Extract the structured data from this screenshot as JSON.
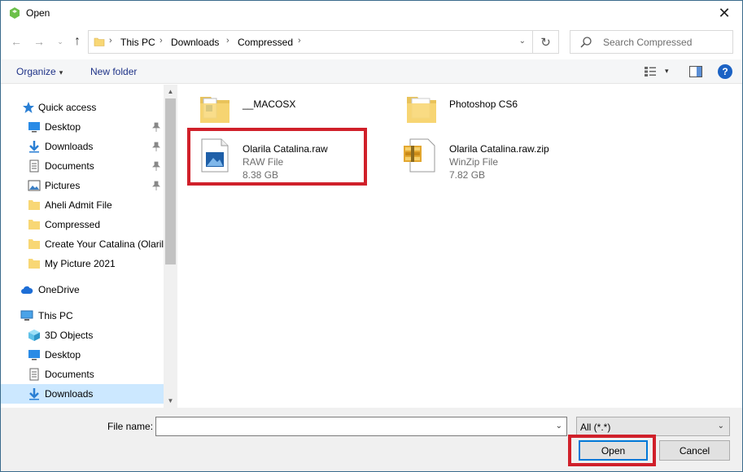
{
  "window": {
    "title": "Open",
    "close_glyph": "✕"
  },
  "nav": {
    "back_glyph": "←",
    "forward_glyph": "→",
    "recent_glyph": "⌄",
    "up_glyph": "↑",
    "breadcrumbs": [
      "This PC",
      "Downloads",
      "Compressed"
    ],
    "separator": "›",
    "dropdown_glyph": "⌄",
    "refresh_glyph": "↻",
    "search_placeholder": "Search Compressed"
  },
  "toolbar": {
    "organize_label": "Organize",
    "new_folder_label": "New folder",
    "caret": "▾",
    "help_label": "?"
  },
  "sidebar": {
    "items": [
      {
        "label": "Quick access",
        "icon": "star-icon",
        "level": 0
      },
      {
        "label": "Desktop",
        "icon": "desktop-icon",
        "level": 1,
        "pinned": true
      },
      {
        "label": "Downloads",
        "icon": "download-icon",
        "level": 1,
        "pinned": true
      },
      {
        "label": "Documents",
        "icon": "documents-icon",
        "level": 1,
        "pinned": true
      },
      {
        "label": "Pictures",
        "icon": "pictures-icon",
        "level": 1,
        "pinned": true
      },
      {
        "label": "Aheli Admit File",
        "icon": "folder-icon",
        "level": 1
      },
      {
        "label": "Compressed",
        "icon": "folder-icon",
        "level": 1
      },
      {
        "label": "Create Your Catalina (Olarila",
        "icon": "folder-icon",
        "level": 1
      },
      {
        "label": "My Picture 2021",
        "icon": "folder-icon",
        "level": 1
      },
      {
        "label": "OneDrive",
        "icon": "cloud-icon",
        "level": 0
      },
      {
        "label": "This PC",
        "icon": "computer-icon",
        "level": 0
      },
      {
        "label": "3D Objects",
        "icon": "cube-icon",
        "level": 1
      },
      {
        "label": "Desktop",
        "icon": "desktop-icon",
        "level": 1
      },
      {
        "label": "Documents",
        "icon": "documents-icon",
        "level": 1
      },
      {
        "label": "Downloads",
        "icon": "download-icon",
        "level": 1,
        "selected": true
      }
    ],
    "scroll_up": "▲",
    "scroll_down": "▼"
  },
  "files": [
    {
      "name": "__MACOSX",
      "type": "",
      "size": "",
      "icon": "folder-icon"
    },
    {
      "name": "Photoshop CS6",
      "type": "",
      "size": "",
      "icon": "folder-icon"
    },
    {
      "name": "Olarila Catalina.raw",
      "type": "RAW File",
      "size": "8.38 GB",
      "icon": "image-file-icon",
      "highlighted": true
    },
    {
      "name": "Olarila Catalina.raw.zip",
      "type": "WinZip File",
      "size": "7.82 GB",
      "icon": "zip-file-icon"
    }
  ],
  "bottom": {
    "file_name_label": "File name:",
    "file_name_value": "",
    "filter_value": "All (*.*)",
    "caret": "⌄",
    "open_label": "Open",
    "cancel_label": "Cancel"
  },
  "colors": {
    "highlight": "#d0202a",
    "accent": "#0078d7",
    "link": "#1e3287"
  }
}
